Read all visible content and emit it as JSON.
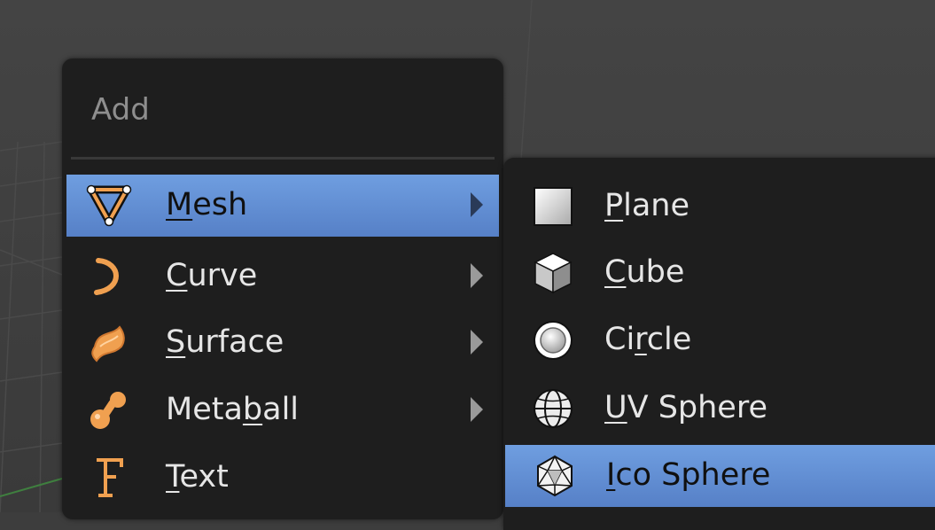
{
  "menu": {
    "title": "Add",
    "items": [
      {
        "pre": "",
        "ul": "M",
        "post": "esh",
        "icon": "mesh-icon",
        "active": true,
        "submenu": true
      },
      {
        "pre": "",
        "ul": "C",
        "post": "urve",
        "icon": "curve-icon",
        "active": false,
        "submenu": true
      },
      {
        "pre": "",
        "ul": "S",
        "post": "urface",
        "icon": "surface-icon",
        "active": false,
        "submenu": true
      },
      {
        "pre": "Meta",
        "ul": "b",
        "post": "all",
        "icon": "metaball-icon",
        "active": false,
        "submenu": true
      },
      {
        "pre": "",
        "ul": "T",
        "post": "ext",
        "icon": "text-icon",
        "active": false,
        "submenu": false
      }
    ]
  },
  "submenu": {
    "items": [
      {
        "pre": "",
        "ul": "P",
        "post": "lane",
        "icon": "plane-icon",
        "active": false
      },
      {
        "pre": "",
        "ul": "C",
        "post": "ube",
        "icon": "cube-icon",
        "active": false
      },
      {
        "pre": "Ci",
        "ul": "r",
        "post": "cle",
        "icon": "circle-icon",
        "active": false
      },
      {
        "pre": "",
        "ul": "U",
        "post": "V Sphere",
        "icon": "uv-sphere-icon",
        "active": false
      },
      {
        "pre": "",
        "ul": "I",
        "post": "co Sphere",
        "icon": "ico-sphere-icon",
        "active": true
      }
    ]
  },
  "colors": {
    "highlight": "#5f8bd4",
    "menu_bg": "#1e1e1e",
    "icon_orange": "#f0a050"
  }
}
